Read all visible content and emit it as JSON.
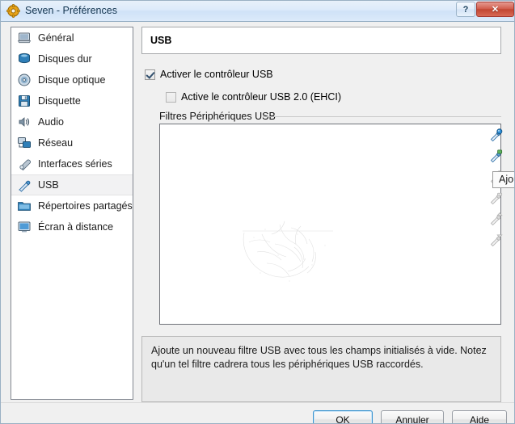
{
  "window": {
    "title": "Seven - Préférences",
    "icon": "gear-icon",
    "help_button": "?",
    "close_button": "✕"
  },
  "sidebar": {
    "items": [
      {
        "label": "Général",
        "icon": "monitor-icon",
        "selected": false
      },
      {
        "label": "Disques dur",
        "icon": "harddisk-icon",
        "selected": false
      },
      {
        "label": "Disque optique",
        "icon": "cd-icon",
        "selected": false
      },
      {
        "label": "Disquette",
        "icon": "floppy-icon",
        "selected": false
      },
      {
        "label": "Audio",
        "icon": "speaker-icon",
        "selected": false
      },
      {
        "label": "Réseau",
        "icon": "network-icon",
        "selected": false
      },
      {
        "label": "Interfaces séries",
        "icon": "serial-port-icon",
        "selected": false
      },
      {
        "label": "USB",
        "icon": "usb-plug-icon",
        "selected": true
      },
      {
        "label": "Répertoires partagés",
        "icon": "shared-folder-icon",
        "selected": false
      },
      {
        "label": "Écran à distance",
        "icon": "remote-display-icon",
        "selected": false
      }
    ]
  },
  "pane": {
    "title": "USB",
    "checkboxes": [
      {
        "label": "Activer le contrôleur USB",
        "checked": true
      },
      {
        "label": "Active le contrôleur USB 2.0 (EHCI)",
        "checked": false
      }
    ],
    "group_label": "Filtres Périphériques USB",
    "filters": [],
    "hint_text": "Ajoute un nouveau filtre USB avec tous les champs initialisés à vide. Notez qu'un tel filtre cadrera tous les périphériques USB raccordés."
  },
  "toolbar": {
    "tooltip": "Ajou",
    "buttons": [
      {
        "icon": "usb-filter-add-icon",
        "enabled": true
      },
      {
        "icon": "usb-filter-add-from-icon",
        "enabled": true
      },
      {
        "icon": "usb-filter-edit-icon",
        "enabled": false
      },
      {
        "icon": "usb-filter-remove-icon",
        "enabled": false
      },
      {
        "icon": "usb-filter-move-up-icon",
        "enabled": false
      },
      {
        "icon": "usb-filter-move-down-icon",
        "enabled": false
      }
    ]
  },
  "footer": {
    "ok_label": "OK",
    "cancel_label": "Annuler",
    "help_label": "Aide"
  },
  "colors": {
    "titlebar": "#dceafa",
    "close_button": "#c24632",
    "default_button_border": "#3c95d0",
    "selected_row": "#f2f2f3",
    "accent_icon": "#2c7fd0"
  }
}
